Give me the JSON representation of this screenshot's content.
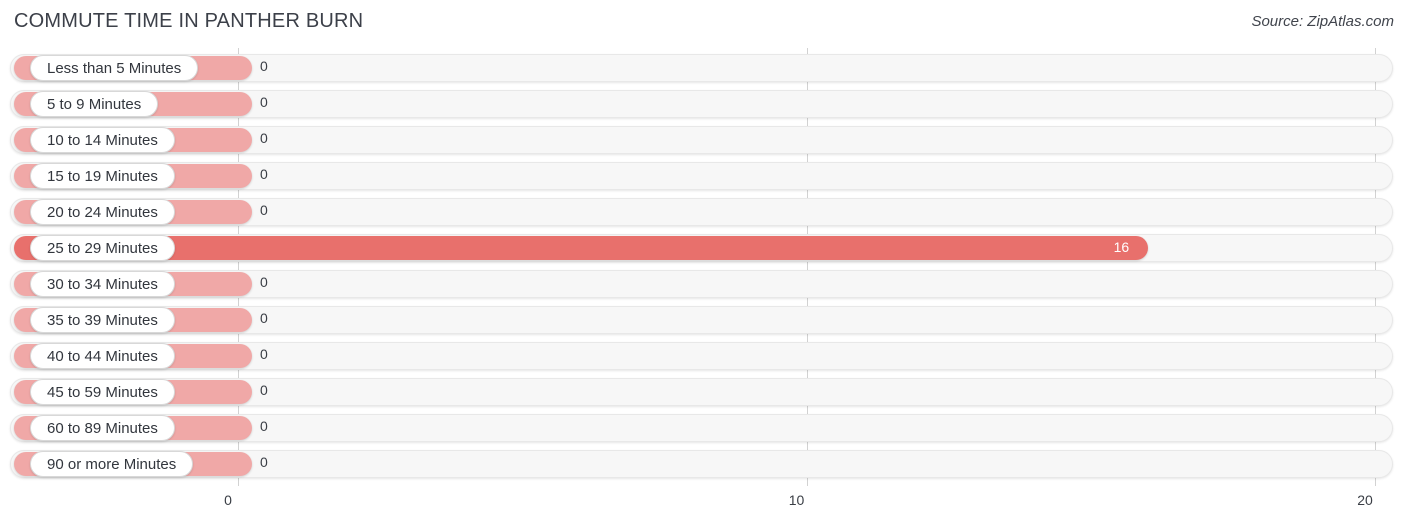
{
  "header": {
    "title": "COMMUTE TIME IN PANTHER BURN",
    "source": "Source: ZipAtlas.com"
  },
  "colors": {
    "bar_default": "#f0a8a7",
    "bar_highlight": "#e8706c",
    "track": "#f7f7f7",
    "gridline": "#d2d2d2",
    "text": "#3a3e45"
  },
  "chart_data": {
    "type": "bar",
    "orientation": "horizontal",
    "title": "COMMUTE TIME IN PANTHER BURN",
    "xlabel": "",
    "ylabel": "",
    "xlim": [
      0,
      20
    ],
    "grid": true,
    "legend": null,
    "xticks": [
      "0",
      "10",
      "20"
    ],
    "xtick_values": [
      0,
      10,
      20
    ],
    "categories": [
      "Less than 5 Minutes",
      "5 to 9 Minutes",
      "10 to 14 Minutes",
      "15 to 19 Minutes",
      "20 to 24 Minutes",
      "25 to 29 Minutes",
      "30 to 34 Minutes",
      "35 to 39 Minutes",
      "40 to 44 Minutes",
      "45 to 59 Minutes",
      "60 to 89 Minutes",
      "90 or more Minutes"
    ],
    "values": [
      0,
      0,
      0,
      0,
      0,
      16,
      0,
      0,
      0,
      0,
      0,
      0
    ],
    "value_labels": [
      "0",
      "0",
      "0",
      "0",
      "0",
      "16",
      "0",
      "0",
      "0",
      "0",
      "0",
      "0"
    ],
    "highlight_index": 5
  }
}
